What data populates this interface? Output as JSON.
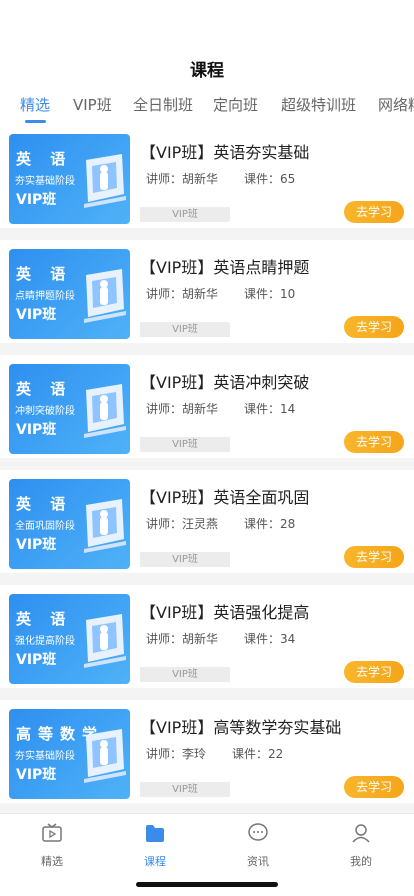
{
  "header": {
    "title": "课程"
  },
  "tabs": [
    "精选",
    "VIP班",
    "全日制班",
    "定向班",
    "超级特训班",
    "网络精"
  ],
  "active_tab": 0,
  "courses": [
    {
      "subject": "英 语",
      "stage": "夯实基础阶段",
      "vip": "VIP班",
      "title": "【VIP班】英语夯实基础",
      "teacher_label": "讲师：",
      "teacher": "胡新华",
      "lessons_label": "课件：",
      "lessons": "65",
      "tag": "VIP班",
      "button": "去学习"
    },
    {
      "subject": "英 语",
      "stage": "点睛押题阶段",
      "vip": "VIP班",
      "title": "【VIP班】英语点睛押题",
      "teacher_label": "讲师：",
      "teacher": "胡新华",
      "lessons_label": "课件：",
      "lessons": "10",
      "tag": "VIP班",
      "button": "去学习"
    },
    {
      "subject": "英 语",
      "stage": "冲刺突破阶段",
      "vip": "VIP班",
      "title": "【VIP班】英语冲刺突破",
      "teacher_label": "讲师：",
      "teacher": "胡新华",
      "lessons_label": "课件：",
      "lessons": "14",
      "tag": "VIP班",
      "button": "去学习"
    },
    {
      "subject": "英 语",
      "stage": "全面巩固阶段",
      "vip": "VIP班",
      "title": "【VIP班】英语全面巩固",
      "teacher_label": "讲师：",
      "teacher": "汪灵燕",
      "lessons_label": "课件：",
      "lessons": "28",
      "tag": "VIP班",
      "button": "去学习"
    },
    {
      "subject": "英 语",
      "stage": "强化提高阶段",
      "vip": "VIP班",
      "title": "【VIP班】英语强化提高",
      "teacher_label": "讲师：",
      "teacher": "胡新华",
      "lessons_label": "课件：",
      "lessons": "34",
      "tag": "VIP班",
      "button": "去学习"
    },
    {
      "subject": "高等数学",
      "stage": "夯实基础阶段",
      "vip": "VIP班",
      "title": "【VIP班】高等数学夯实基础",
      "teacher_label": "讲师：",
      "teacher": "李玲",
      "lessons_label": "课件：",
      "lessons": "22",
      "tag": "VIP班",
      "button": "去学习"
    }
  ],
  "tabbar": [
    {
      "label": "精选",
      "icon": "tv-icon"
    },
    {
      "label": "课程",
      "icon": "folder-icon"
    },
    {
      "label": "资讯",
      "icon": "chat-icon"
    },
    {
      "label": "我的",
      "icon": "user-icon"
    }
  ],
  "active_tabbar": 1,
  "colors": {
    "accent": "#3b8bea",
    "button": "#f5a51a"
  }
}
